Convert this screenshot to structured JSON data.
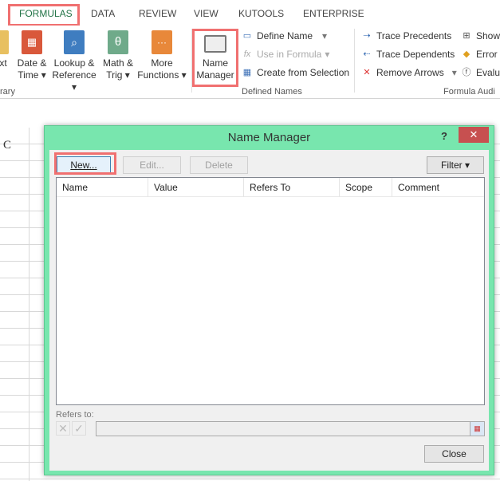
{
  "ribbon_tabs": [
    {
      "label": "FORMULAS",
      "active": true
    },
    {
      "label": "DATA"
    },
    {
      "label": "REVIEW"
    },
    {
      "label": "VIEW"
    },
    {
      "label": "KUTOOLS"
    },
    {
      "label": "ENTERPRISE"
    }
  ],
  "function_library": {
    "partial_label": "rary",
    "buttons": [
      {
        "line1": "xt",
        "line2": "",
        "color": "#e8c060"
      },
      {
        "line1": "Date &",
        "line2": "Time ▾",
        "color": "#d9583b",
        "icon": "calendar-icon"
      },
      {
        "line1": "Lookup &",
        "line2": "Reference ▾",
        "color": "#3f7dc0",
        "icon": "magnifier-icon"
      },
      {
        "line1": "Math &",
        "line2": "Trig ▾",
        "color": "#6faa8a",
        "icon": "theta-icon"
      },
      {
        "line1": "More",
        "line2": "Functions ▾",
        "color": "#e8883a",
        "icon": "ellipsis-icon"
      }
    ]
  },
  "defined_names": {
    "group_label": "Defined Names",
    "name_manager": {
      "line1": "Name",
      "line2": "Manager"
    },
    "define_name": "Define Name",
    "use_in_formula": "Use in Formula",
    "create_from_selection": "Create from Selection"
  },
  "formula_auditing": {
    "group_label": "Formula Audi",
    "trace_precedents": "Trace Precedents",
    "trace_dependents": "Trace Dependents",
    "remove_arrows": "Remove Arrows",
    "show": "Show",
    "error": "Error",
    "evaluate": "Evalu"
  },
  "sheet": {
    "column_label": "C"
  },
  "dialog": {
    "title": "Name Manager",
    "help": "?",
    "close_x": "✕",
    "new_label": "New...",
    "edit_label": "Edit...",
    "delete_label": "Delete",
    "filter_label": "Filter ▾",
    "columns": [
      "Name",
      "Value",
      "Refers To",
      "Scope",
      "Comment"
    ],
    "refers_to_label": "Refers to:",
    "refers_to_value": "",
    "close_label": "Close"
  },
  "colors": {
    "accent": "#217346",
    "highlight": "#f07070",
    "dialog_frame": "#78e6ae",
    "close_red": "#c75050"
  }
}
